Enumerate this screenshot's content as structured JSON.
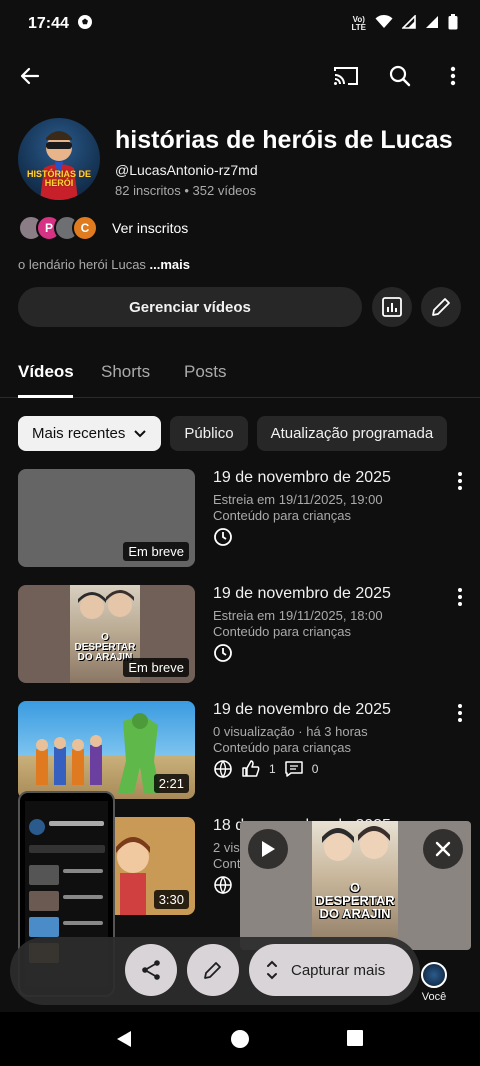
{
  "status": {
    "time": "17:44",
    "network": "Vo) LTE"
  },
  "channel": {
    "title": "histórias de heróis de Lucas",
    "handle": "@LucasAntonio-rz7md",
    "stats": "82 inscritos • 352 vídeos",
    "avatar_text": "HISTÓRIAS DE HERÓI",
    "subscribers_label": "Ver inscritos",
    "sub_avatars": [
      {
        "letter": "",
        "color": "#8a7d86"
      },
      {
        "letter": "P",
        "color": "#d63384"
      },
      {
        "letter": "",
        "color": "#6d6f72"
      },
      {
        "letter": "C",
        "color": "#e07b20"
      }
    ],
    "description": "o lendário herói Lucas ",
    "more": "...mais"
  },
  "manage_button": "Gerenciar vídeos",
  "tabs": [
    {
      "label": "Vídeos",
      "active": true
    },
    {
      "label": "Shorts",
      "active": false
    },
    {
      "label": "Posts",
      "active": false
    }
  ],
  "chips": [
    {
      "label": "Mais recentes",
      "selected": true
    },
    {
      "label": "Público",
      "selected": false
    },
    {
      "label": "Atualização programada",
      "selected": false
    }
  ],
  "videos": [
    {
      "title": "19 de novembro de 2025",
      "line1": "Estreia em 19/11/2025, 19:00",
      "line2": "Conteúdo para crianças",
      "badge": "Em breve",
      "thumb": "gray"
    },
    {
      "title": "19 de novembro de 2025",
      "line1": "Estreia em 19/11/2025, 18:00",
      "line2": "Conteúdo para crianças",
      "badge": "Em breve",
      "thumb": "comic",
      "comic_title": "O DESPERTAR DO ARAJIN"
    },
    {
      "title": "19 de novembro de 2025",
      "line1": "0 visualização · há 3 horas",
      "line2": "Conteúdo para crianças",
      "badge": "2:21",
      "likes": "1",
      "comments": "0",
      "thumb": "anime"
    },
    {
      "title": "18 de novembro de 2025",
      "line1": "2 visualizações",
      "line2": "Conteúdo para crianças",
      "badge": "3:30",
      "thumb": "cartoon"
    }
  ],
  "pip": {
    "art_title": "O DESPERTAR DO ARAJIN"
  },
  "screenshot_toolbar": {
    "capture_label": "Capturar mais"
  },
  "bottom_nav": {
    "you_label": "Você"
  },
  "colors": {
    "background": "#0f0f0f",
    "chip": "#272727",
    "muted_text": "#aaaaaa"
  }
}
